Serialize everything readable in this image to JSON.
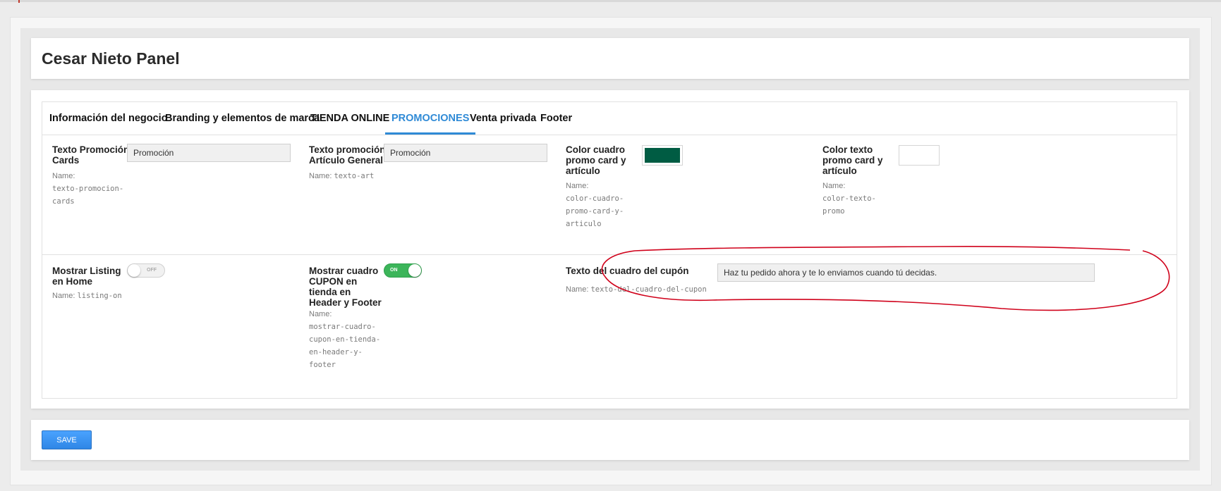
{
  "panel": {
    "title": "Cesar Nieto Panel"
  },
  "tabs": [
    {
      "label": "Información del negocio"
    },
    {
      "label": "Branding y elementos de marca"
    },
    {
      "label": "TIENDA ONLINE"
    },
    {
      "label": "PROMOCIONES",
      "active": true
    },
    {
      "label": "Venta privada"
    },
    {
      "label": "Footer"
    }
  ],
  "fields": {
    "texto_promocion_cards": {
      "label_line1": "Texto Promoción",
      "label_line2": "Cards",
      "value": "Promoción",
      "name_prefix": "Name:",
      "name_lines": [
        "texto-promocion-",
        "cards"
      ]
    },
    "texto_art": {
      "label_line1": "Texto promoción",
      "label_line2": "Artículo General",
      "value": "Promoción",
      "name_prefix": "Name:",
      "name_value": "texto-art"
    },
    "color_cuadro": {
      "label_lines": [
        "Color cuadro",
        "promo card y",
        "artículo"
      ],
      "color": "#005c43",
      "name_prefix": "Name:",
      "name_lines": [
        "color-cuadro-",
        "promo-card-y-",
        "articulo"
      ]
    },
    "color_texto": {
      "label_lines": [
        "Color texto",
        "promo card y",
        "artículo"
      ],
      "color": "#ffffff",
      "name_prefix": "Name:",
      "name_lines": [
        "color-texto-",
        "promo"
      ]
    },
    "mostrar_listing": {
      "label_lines": [
        "Mostrar Listing",
        "en Home"
      ],
      "toggle_text": "OFF",
      "state": "off",
      "name_prefix": "Name:",
      "name_value": "listing-on"
    },
    "mostrar_cupon": {
      "label_lines": [
        "Mostrar cuadro",
        "CUPON en",
        "tienda en",
        "Header y Footer"
      ],
      "toggle_text": "ON",
      "state": "on",
      "name_prefix": "Name:",
      "name_lines": [
        "mostrar-cuadro-",
        "cupon-en-tienda-",
        "en-header-y-",
        "footer"
      ]
    },
    "texto_cupon": {
      "label": "Texto del cuadro del cupón",
      "value": "Haz tu pedido ahora y te lo enviamos cuando tú decidas.",
      "name_prefix": "Name:",
      "name_value": "texto-del-cuadro-del-cupon"
    }
  },
  "toolbar": {
    "save_label": "SAVE"
  },
  "colors": {
    "accent": "#2f8ad6",
    "toggle_on": "#3cb55a",
    "annotation": "#d0021b",
    "save_button": "#3b94f3"
  }
}
